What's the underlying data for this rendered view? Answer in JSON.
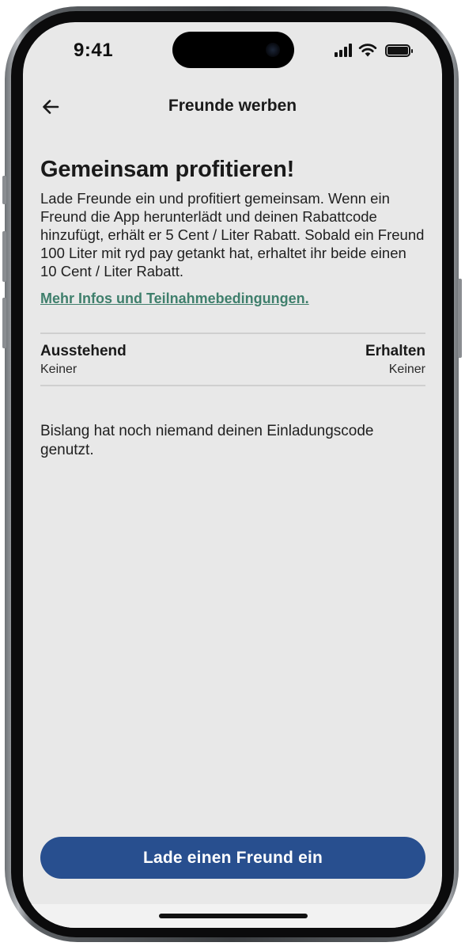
{
  "status_bar": {
    "time": "9:41",
    "icons": [
      "cellular-signal-icon",
      "wifi-icon",
      "battery-icon"
    ]
  },
  "header": {
    "back_icon": "arrow-left-icon",
    "title": "Freunde werben"
  },
  "main": {
    "headline": "Gemeinsam profitieren!",
    "intro": "Lade Freunde ein und profitiert gemeinsam. Wenn ein Freund die App herunterlädt und deinen Rabattcode hinzufügt, erhält er 5 Cent / Liter Rabatt. Sobald ein Freund 100 Liter mit ryd pay getankt hat, erhaltet ihr beide einen 10 Cent / Liter Rabatt.",
    "more_link": "Mehr Infos und Teilnahmebedingungen."
  },
  "stats": {
    "pending_label": "Ausstehend",
    "pending_value": "Keiner",
    "received_label": "Erhalten",
    "received_value": "Keiner"
  },
  "empty_message": "Bislang hat noch niemand deinen Einladungscode genutzt.",
  "cta": {
    "label": "Lade einen Freund ein"
  },
  "colors": {
    "background": "#e8e8e8",
    "link": "#3f7f6c",
    "primary_button": "#284f8f",
    "button_text": "#ffffff"
  }
}
